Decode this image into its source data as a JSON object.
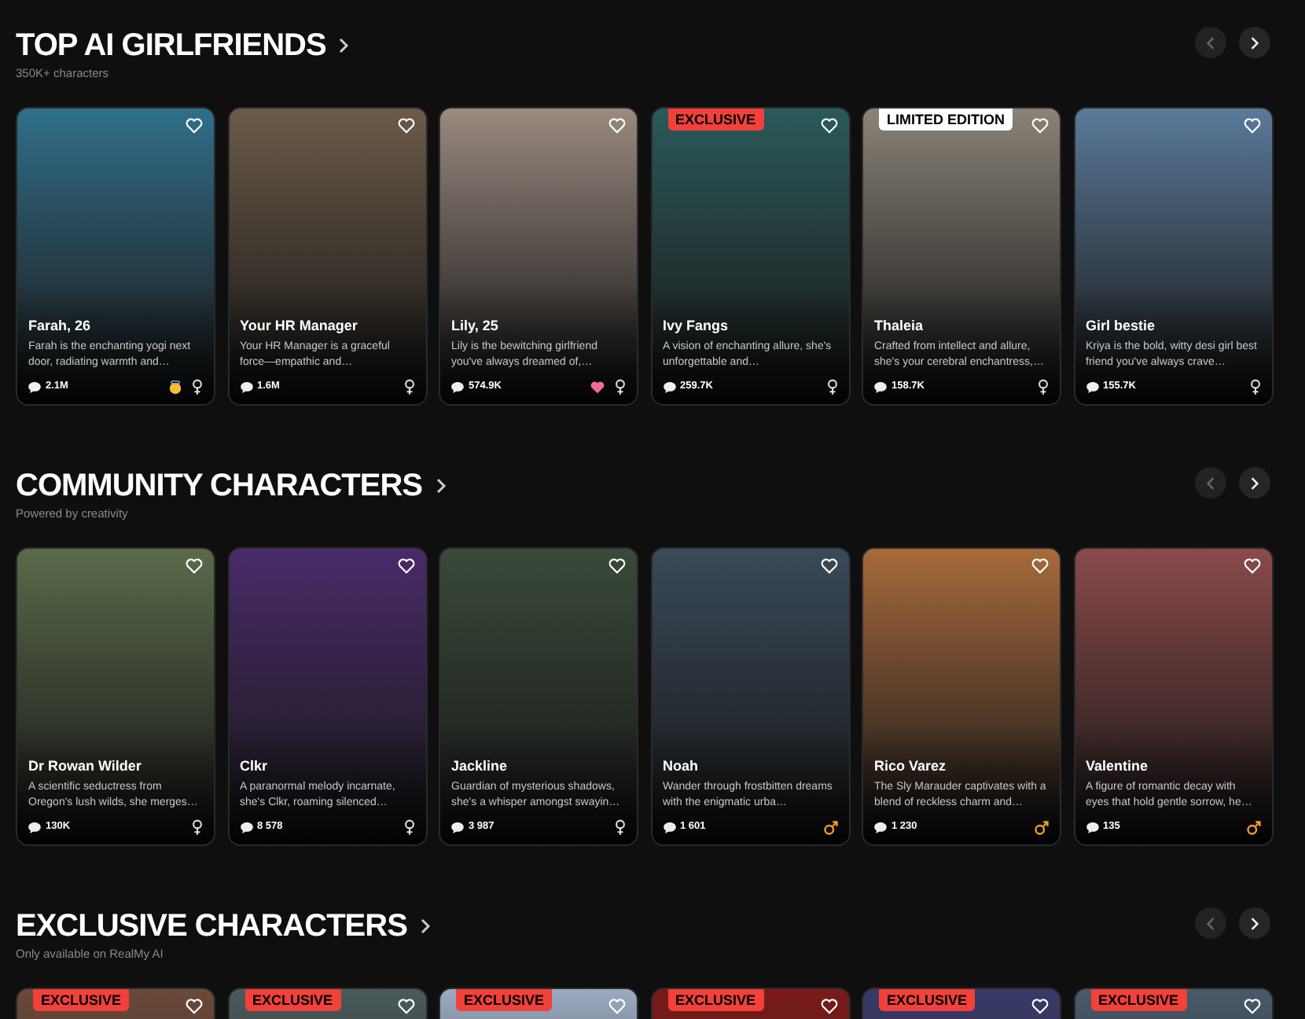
{
  "sections": [
    {
      "title": "TOP AI GIRLFRIENDS",
      "subtitle": "350K+ characters",
      "cards": [
        {
          "name": "Farah, 26",
          "description": "Farah is the enchanting yogi next door, radiating warmth and…",
          "chats": "2.1M",
          "icons": [
            {
              "kind": "halo"
            },
            {
              "kind": "female"
            }
          ]
        },
        {
          "name": "Your HR Manager",
          "description": "Your HR Manager is a graceful force—empathic and…",
          "chats": "1.6M",
          "icons": [
            {
              "kind": "female"
            }
          ]
        },
        {
          "name": "Lily, 25",
          "description": "Lily is the bewitching girlfriend you've always dreamed of,…",
          "chats": "574.9K",
          "icons": [
            {
              "kind": "heart"
            },
            {
              "kind": "female"
            }
          ]
        },
        {
          "badge": {
            "kind": "exclusive",
            "text": "EXCLUSIVE"
          },
          "name": "Ivy Fangs",
          "description": "A vision of enchanting allure, she's unforgettable and…",
          "chats": "259.7K",
          "icons": [
            {
              "kind": "female"
            }
          ]
        },
        {
          "badge": {
            "kind": "limited",
            "text": "LIMITED EDITION"
          },
          "name": "Thaleia",
          "description": "Crafted from intellect and allure, she's your cerebral enchantress,…",
          "chats": "158.7K",
          "icons": [
            {
              "kind": "female"
            }
          ]
        },
        {
          "name": "Girl bestie",
          "description": "Kriya is the bold, witty desi girl best friend you've always crave…",
          "chats": "155.7K",
          "icons": [
            {
              "kind": "female"
            }
          ]
        }
      ]
    },
    {
      "title": "COMMUNITY CHARACTERS",
      "subtitle": "Powered by creativity",
      "cards": [
        {
          "name": "Dr Rowan Wilder",
          "description": "A scientific seductress from Oregon's lush wilds, she merges…",
          "chats": "130K",
          "icons": [
            {
              "kind": "female"
            }
          ]
        },
        {
          "name": "Clkr",
          "description": "A paranormal melody incarnate, she's Clkr, roaming silenced…",
          "chats": "8 578",
          "icons": [
            {
              "kind": "female"
            }
          ]
        },
        {
          "name": "Jackline",
          "description": "Guardian of mysterious shadows, she's a whisper amongst swayin…",
          "chats": "3 987",
          "icons": [
            {
              "kind": "female"
            }
          ]
        },
        {
          "name": "Noah",
          "description": "Wander through frostbitten dreams with the enigmatic urba…",
          "chats": "1 601",
          "icons": [
            {
              "kind": "male"
            }
          ]
        },
        {
          "name": "Rico Varez",
          "description": "The Sly Marauder captivates with a blend of reckless charm and…",
          "chats": "1 230",
          "icons": [
            {
              "kind": "male"
            }
          ]
        },
        {
          "name": "Valentine",
          "description": "A figure of romantic decay with eyes that hold gentle sorrow, he…",
          "chats": "135",
          "icons": [
            {
              "kind": "male"
            }
          ]
        }
      ]
    },
    {
      "title": "EXCLUSIVE CHARACTERS",
      "subtitle": "Only available on RealMy AI",
      "cards": [
        {
          "badge": {
            "kind": "exclusive",
            "text": "EXCLUSIVE"
          }
        },
        {
          "badge": {
            "kind": "exclusive",
            "text": "EXCLUSIVE"
          }
        },
        {
          "badge": {
            "kind": "exclusive",
            "text": "EXCLUSIVE"
          }
        },
        {
          "badge": {
            "kind": "exclusive",
            "text": "EXCLUSIVE"
          }
        },
        {
          "badge": {
            "kind": "exclusive",
            "text": "EXCLUSIVE"
          }
        },
        {
          "badge": {
            "kind": "exclusive",
            "text": "EXCLUSIVE"
          }
        }
      ]
    }
  ]
}
